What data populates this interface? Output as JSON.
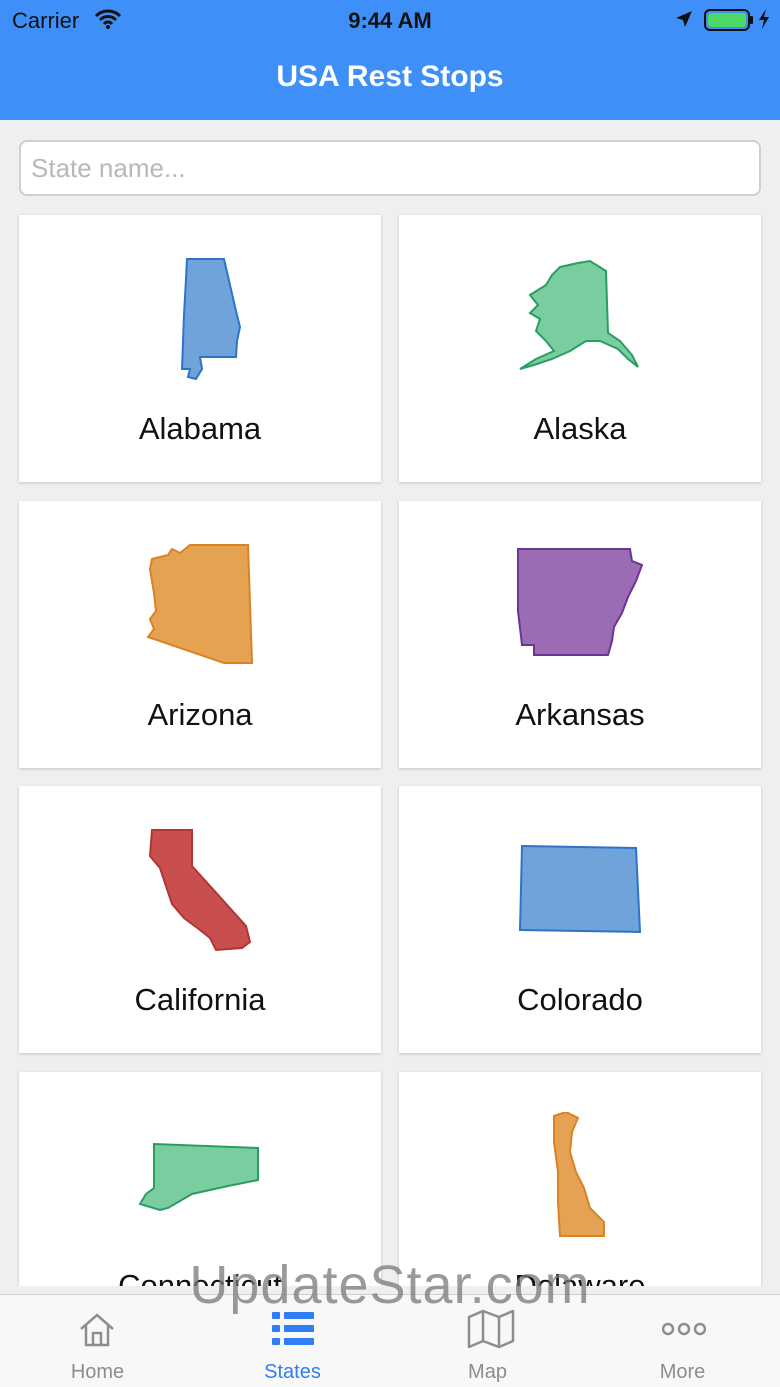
{
  "status_bar": {
    "carrier": "Carrier",
    "time": "9:44 AM"
  },
  "nav": {
    "title": "USA Rest Stops"
  },
  "search": {
    "placeholder": "State name..."
  },
  "states": [
    {
      "name": "Alabama",
      "color": "#6fa3da"
    },
    {
      "name": "Alaska",
      "color": "#7acd9f"
    },
    {
      "name": "Arizona",
      "color": "#e6a253"
    },
    {
      "name": "Arkansas",
      "color": "#9b6cb4"
    },
    {
      "name": "California",
      "color": "#c94e4e"
    },
    {
      "name": "Colorado",
      "color": "#6fa3da"
    },
    {
      "name": "Connecticut",
      "color": "#7acd9f"
    },
    {
      "name": "Delaware",
      "color": "#e6a253"
    }
  ],
  "tabbar": {
    "home": "Home",
    "states": "States",
    "map": "Map",
    "more": "More",
    "active_color": "#2f7ef5"
  },
  "watermark": "UpdateStar.com"
}
